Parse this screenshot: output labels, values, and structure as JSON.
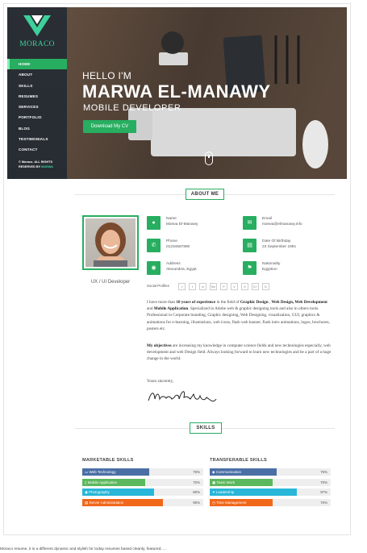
{
  "brand": {
    "name": "MORACO"
  },
  "nav": {
    "items": [
      {
        "label": "HOME"
      },
      {
        "label": "ABOUT"
      },
      {
        "label": "SKILLS"
      },
      {
        "label": "RESUMES"
      },
      {
        "label": "SERVICES"
      },
      {
        "label": "PORTFOLIO"
      },
      {
        "label": "BLOG"
      },
      {
        "label": "TESTIMONIALS"
      },
      {
        "label": "CONTACT"
      }
    ],
    "copyright_line1": "© Moraco. ALL RIGHTS",
    "copyright_line2_prefix": "RESERVED BY ",
    "copyright_line2_name": "MARWA"
  },
  "hero": {
    "greeting": "HELLO I'M",
    "name": "MARWA EL-MANAWY",
    "role": "MOBILE DEVELOPER",
    "cta": "Download My CV"
  },
  "about": {
    "title": "ABOUT ME",
    "photo_label": "UX / UI Developer",
    "info": [
      {
        "label": "Name",
        "value": "Marwa El-Manawy",
        "icon": "user-icon"
      },
      {
        "label": "Email",
        "value": "marwa@elmanawy.info",
        "icon": "email-icon"
      },
      {
        "label": "Phone",
        "value": "01234567890",
        "icon": "phone-icon"
      },
      {
        "label": "Date Of Birthday",
        "value": "23 September 1991",
        "icon": "calendar-icon"
      },
      {
        "label": "Address",
        "value": "Alexandria, Egypt",
        "icon": "map-marker-icon"
      },
      {
        "label": "Nationality",
        "value": "Egyption",
        "icon": "flag-icon"
      }
    ],
    "social_label": "Social Profiles",
    "social": [
      "f",
      "t",
      "in",
      "Be",
      "P",
      "V",
      "S",
      "G+",
      "D"
    ],
    "bio1_parts": {
      "a": "I have more than ",
      "b": "10 years of experience",
      "c": " in the field of ",
      "d": "Graphic Design",
      "e": " , ",
      "f": "Web Design, Web Development",
      "g": " and ",
      "h": "Mobile Application",
      "i": ". Specialized in Adobe web & graphic designing tools and also in others tools. Professional in Corporate branding, Graphic designing, Web Designing, visualization, GUI, graphics & animations for e-learning, illustrations, web icons, flash web banner, flash intro animations, logos, brochures, posters etc."
    },
    "bio2_parts": {
      "a": "My objectives",
      "b": " are increasing my knowledge in computer science fields and new technologies especially, web development and web Design field. Always looking forward to learn new technologies and be a part of a huge change in the world."
    },
    "closing": "Yours sincerely,"
  },
  "skills": {
    "title": "SKILLS",
    "marketable_title": "MARKETABLE SKILLS",
    "transferable_title": "TRANSFERABLE SKILLS",
    "marketable": [
      {
        "name": "Web Technology",
        "percent": 75,
        "percent_label": "75%",
        "color": "#4a6fa5"
      },
      {
        "name": "Mobile Application",
        "percent": 70,
        "percent_label": "70%",
        "color": "#5cb85c"
      },
      {
        "name": "Photography",
        "percent": 80,
        "percent_label": "80%",
        "color": "#29b6d8"
      },
      {
        "name": "Server Administration",
        "percent": 90,
        "percent_label": "90%",
        "color": "#f0671a"
      }
    ],
    "transferable": [
      {
        "name": "Communication",
        "percent": 75,
        "percent_label": "75%",
        "color": "#4a6fa5"
      },
      {
        "name": "Team Work",
        "percent": 70,
        "percent_label": "70%",
        "color": "#5cb85c"
      },
      {
        "name": "Leadership",
        "percent": 97,
        "percent_label": "97%",
        "color": "#29b6d8"
      },
      {
        "name": "Time Management",
        "percent": 70,
        "percent_label": "70%",
        "color": "#f0671a"
      }
    ]
  },
  "caption": "Moraco resume, it is a different dynamic and stylish for today resumes based cleanly, featured, ..."
}
